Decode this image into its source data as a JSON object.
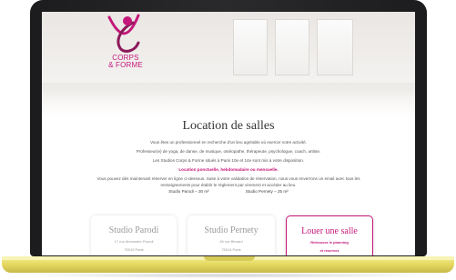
{
  "brand": {
    "logo_text": "CORPS\n& FORME",
    "accent_color": "#c4177a"
  },
  "page": {
    "title": "Location de salles",
    "intro": "Vous êtes un professionnel en recherche d'un lieu agréable où exercer votre activité.",
    "professions": "Professeur(e) de yoga, de danse, de musique, ostéopathe, thérapeute, psychologue, coach, artiste.",
    "studios_line": "Les Studios Corps & Forme situés à Paris 10e et 14e sont mis à votre disposition.",
    "rental_types": "Location ponctuelle, hebdomadaire ou mensuelle.",
    "booking_line1": "Vous pouvez dès maintenant réserver en ligne ci-dessous. Suite à votre validation de réservation, nous vous enverrons un email avec tous les",
    "booking_line2": "renseignements pour établir le règlement par virement et accéder au lieu.",
    "size_parodi": "Studio Parodi – 30 m²",
    "size_pernety": "Studio Pernety – 25 m²"
  },
  "cards": [
    {
      "title": "Studio Parodi",
      "sub1": "17 rue Alexandre Parodi",
      "sub2": "75010 Paris"
    },
    {
      "title": "Studio Pernety",
      "sub1": "46 rue Bénard",
      "sub2": "75014 Paris"
    },
    {
      "title": "Louer une salle",
      "sub1": "Retrouvez le planning",
      "sub2": "et réservez"
    }
  ],
  "device": {
    "base_color": "#e6da63",
    "bezel_color": "#1c1c1e"
  }
}
